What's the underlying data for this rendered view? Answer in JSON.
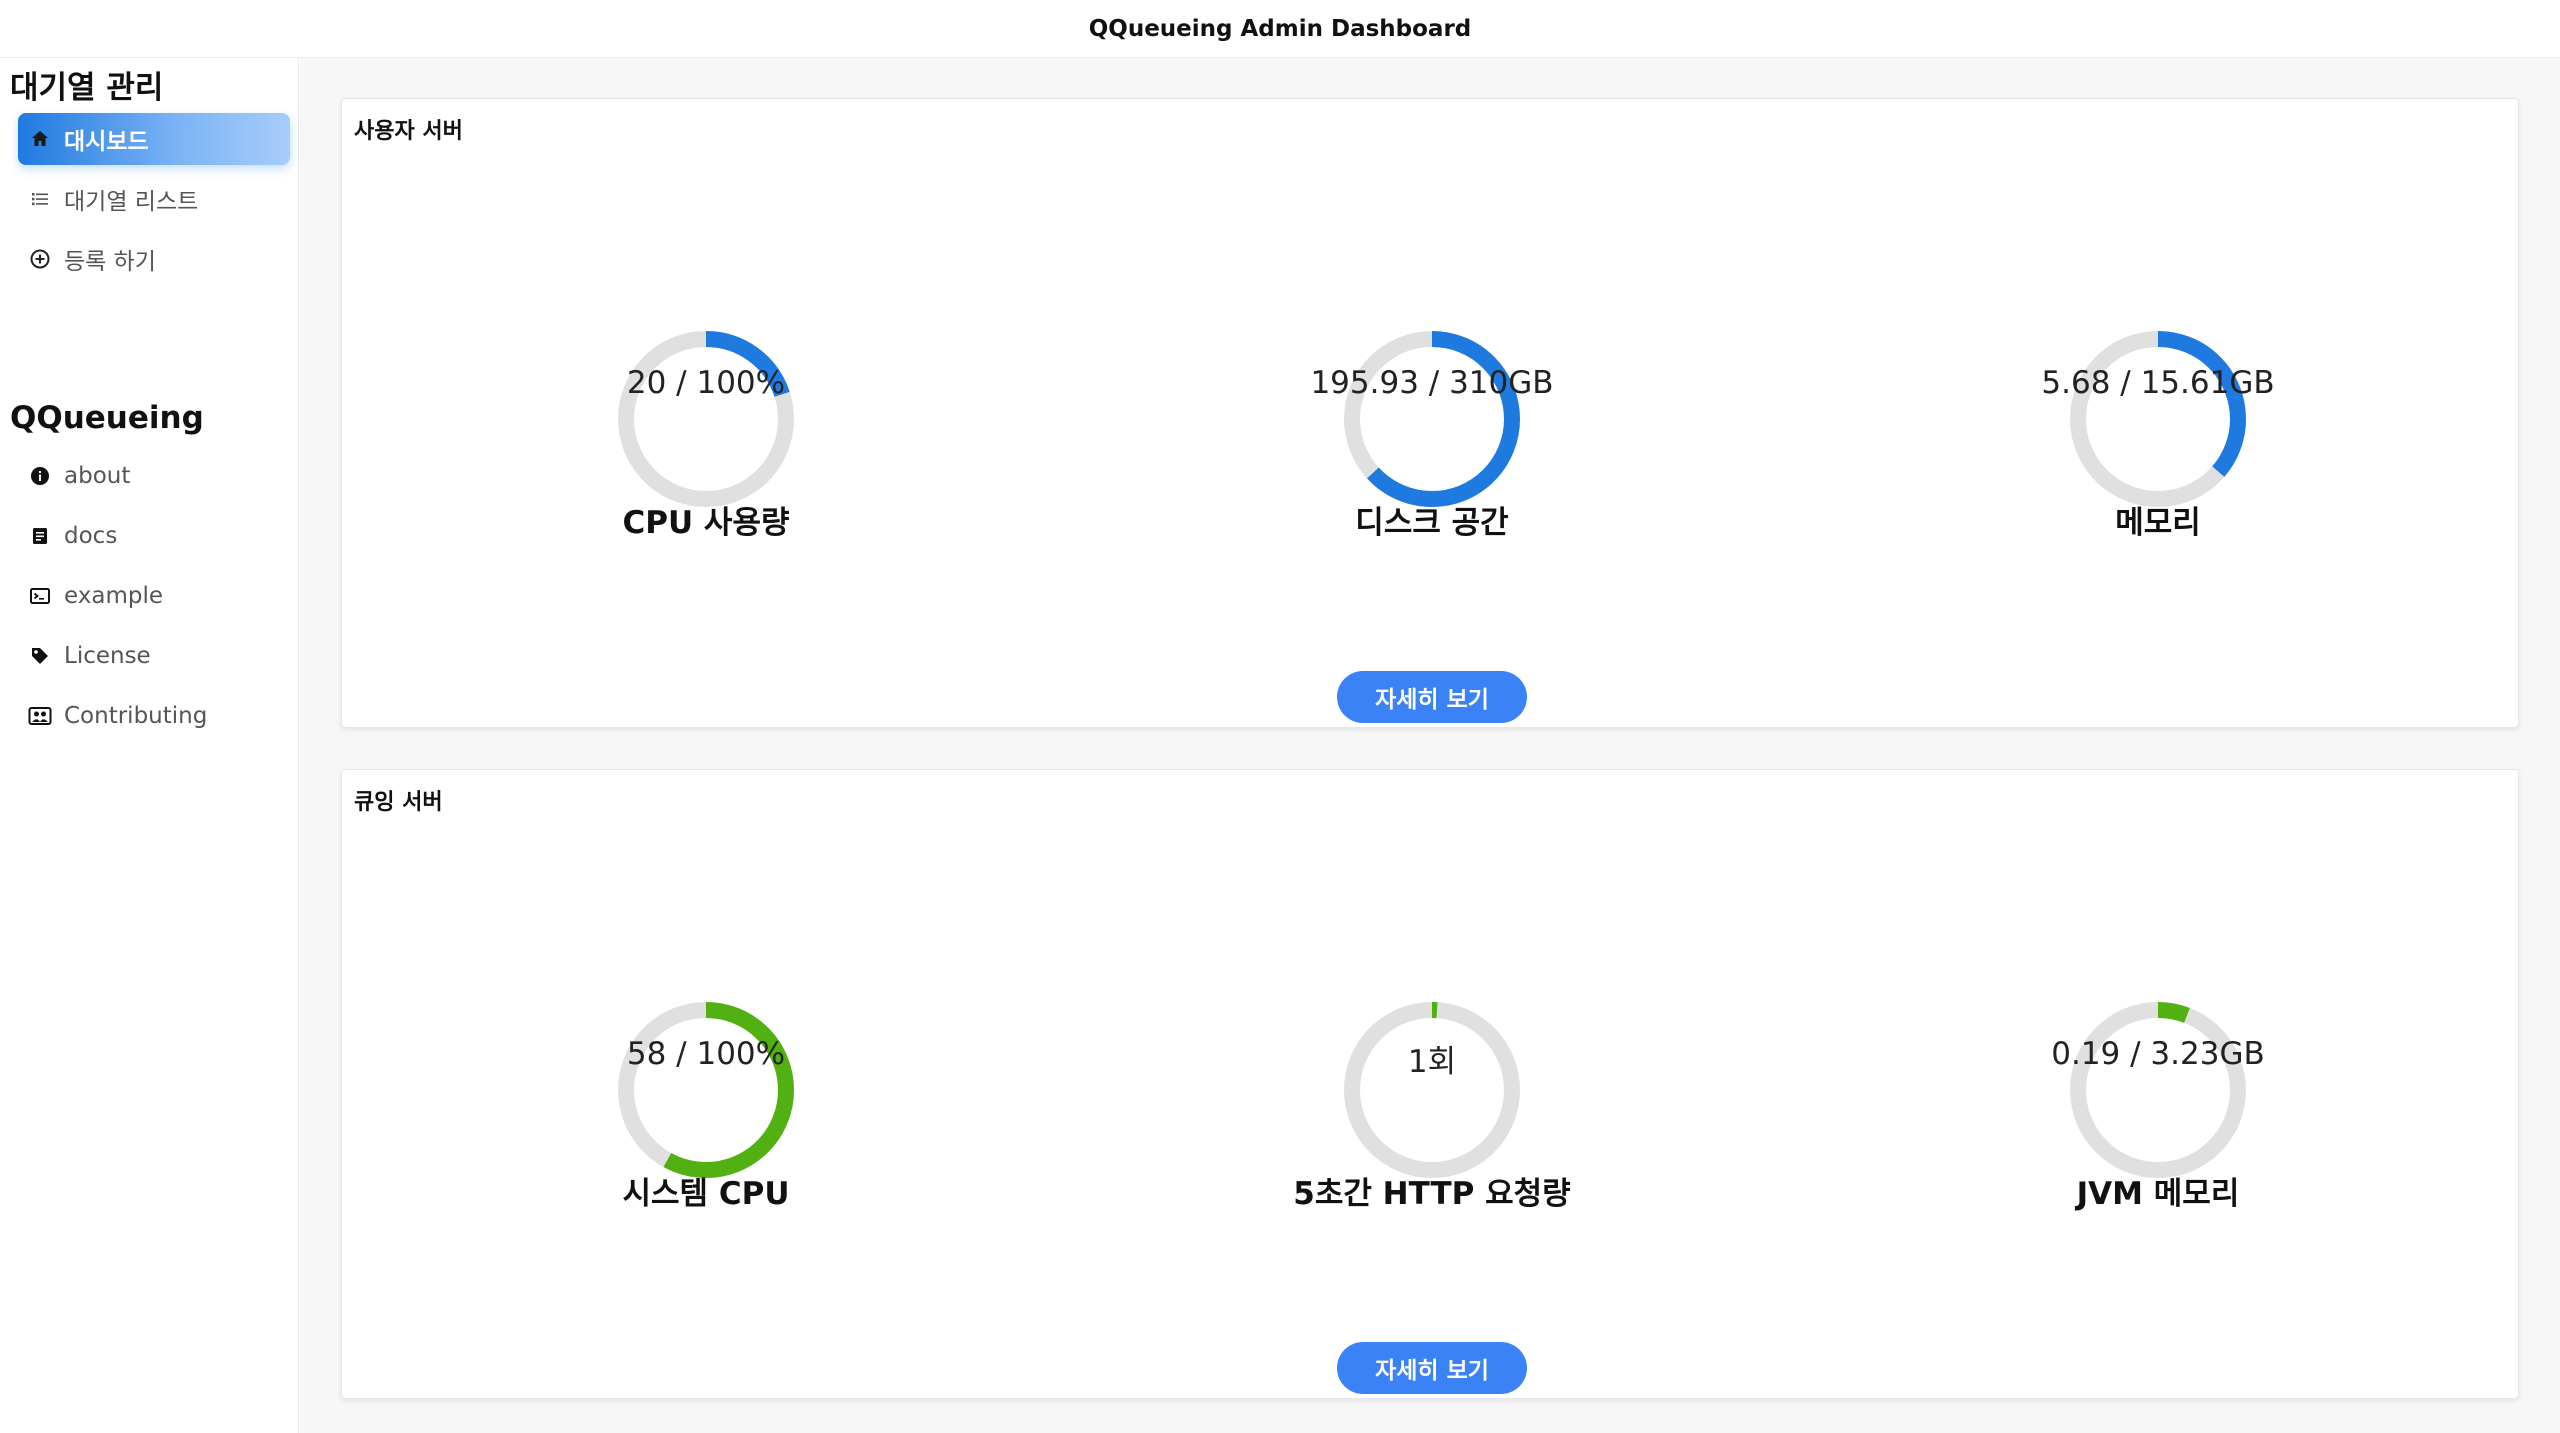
{
  "app_title": "QQueueing Admin Dashboard",
  "sidebar": {
    "section1_title": "대기열 관리",
    "items": [
      {
        "label": "대시보드",
        "icon": "home-icon"
      },
      {
        "label": "대기열 리스트",
        "icon": "list-icon"
      },
      {
        "label": "등록 하기",
        "icon": "add-circle-icon"
      }
    ],
    "section2_title": "QQueueing",
    "links": [
      {
        "label": "about",
        "icon": "info-icon"
      },
      {
        "label": "docs",
        "icon": "document-icon"
      },
      {
        "label": "example",
        "icon": "terminal-icon"
      },
      {
        "label": "License",
        "icon": "tag-icon"
      },
      {
        "label": "Contributing",
        "icon": "people-icon"
      }
    ]
  },
  "cards": [
    {
      "title": "사용자 서버",
      "button": "자세히 보기",
      "color": "#1f7ae0",
      "gauges": [
        {
          "value_text": "20 / 100%",
          "label": "CPU 사용량",
          "fraction": 0.2
        },
        {
          "value_text": "195.93 / 310GB",
          "label": "디스크 공간",
          "fraction": 0.632
        },
        {
          "value_text": "5.68 / 15.61GB",
          "label": "메모리",
          "fraction": 0.364
        }
      ]
    },
    {
      "title": "큐잉 서버",
      "button": "자세히 보기",
      "color": "#52b012",
      "gauges": [
        {
          "value_text": "58 / 100%",
          "label": "시스템 CPU",
          "fraction": 0.58
        },
        {
          "value_text": "1회",
          "label": "5초간 HTTP 요청량",
          "fraction": 0.01
        },
        {
          "value_text": "0.19 / 3.23GB",
          "label": "JVM 메모리",
          "fraction": 0.059
        }
      ]
    }
  ],
  "colors": {
    "track": "#e0e0e0",
    "accent_blue": "#3b82f6"
  }
}
